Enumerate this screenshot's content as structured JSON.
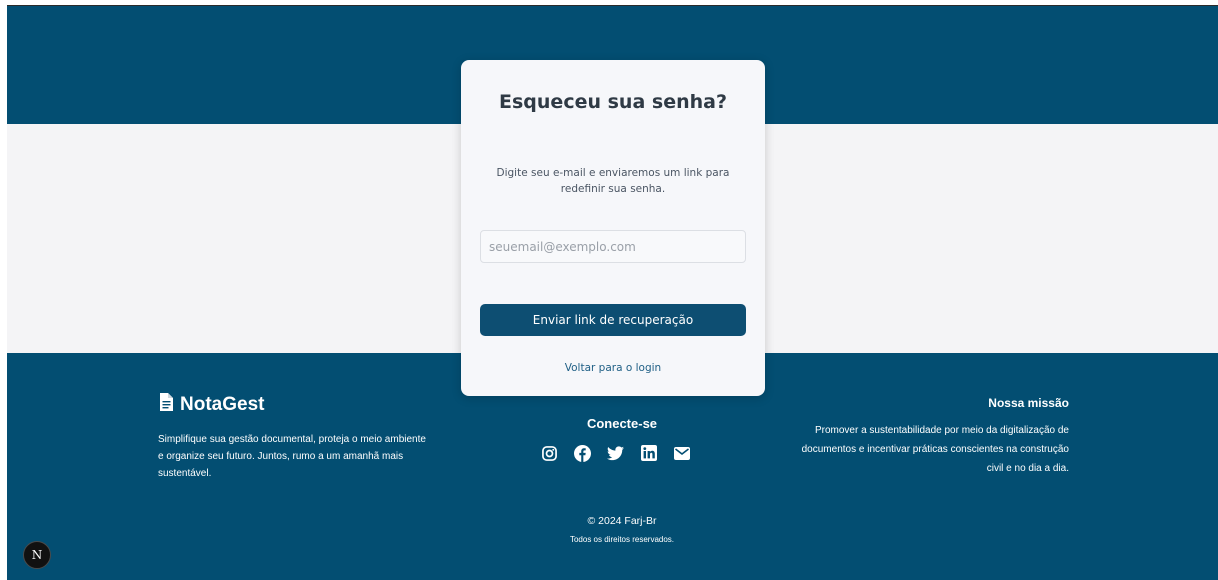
{
  "card": {
    "title": "Esqueceu sua senha?",
    "description": "Digite seu e-mail e enviaremos um link para redefinir sua senha.",
    "email_placeholder": "seuemail@exemplo.com",
    "email_value": "",
    "submit_label": "Enviar link de recuperação",
    "back_label": "Voltar para o login"
  },
  "footer": {
    "brand": {
      "icon": "document-icon",
      "name": "NotaGest",
      "description": "Simplifique sua gestão documental, proteja o meio ambiente e organize seu futuro. Juntos, rumo a um amanhã mais sustentável."
    },
    "connect": {
      "title": "Conecte-se",
      "socials": [
        "instagram-icon",
        "facebook-icon",
        "twitter-icon",
        "linkedin-icon",
        "mail-icon"
      ]
    },
    "mission": {
      "title": "Nossa missão",
      "text": "Promover a sustentabilidade por meio da digitalização de documentos e incentivar práticas conscientes na construção civil e no dia a dia."
    },
    "copyright": "© 2024 Farj-Br",
    "rights": "Todos os direitos reservados."
  },
  "badge": {
    "label": "N"
  },
  "colors": {
    "primary": "#034e72",
    "button": "#0d4e72",
    "background_gray": "#f4f4f6",
    "card": "#f6f7fa"
  }
}
